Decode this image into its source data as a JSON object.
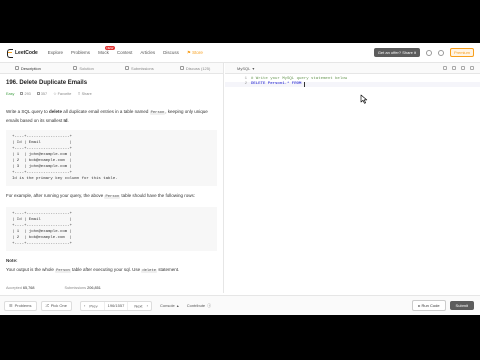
{
  "nav": {
    "logo": "LeetCode",
    "links": [
      "Explore",
      "Problems",
      "Mock",
      "Contest",
      "Articles",
      "Discuss"
    ],
    "hot_badge": "NEW",
    "store": "Store",
    "offer": "Get an offer? Share it",
    "premium": "Premium"
  },
  "tabs": [
    "Description",
    "Solution",
    "Submissions",
    "Discuss (125)"
  ],
  "problem": {
    "title": "196. Delete Duplicate Emails",
    "difficulty": "Easy",
    "likes": "293",
    "dislikes": "357",
    "favorite": "Favorite",
    "share": "Share",
    "desc_pre": "Write a SQL query to ",
    "desc_bold": "delete",
    "desc_mid": " all duplicate email entries in a table named ",
    "desc_table": "Person",
    "desc_post": ", keeping only unique emails based on its smallest ",
    "desc_id": "Id",
    "table1": "+----+------------------+\n| Id | Email            |\n+----+------------------+\n| 1  | john@example.com |\n| 2  | bob@example.com  |\n| 3  | john@example.com |\n+----+------------------+\nId is the primary key column for this table.",
    "example_pre": "For example, after running your query, the above ",
    "example_table": "Person",
    "example_post": " table should have the following rows:",
    "table2": "+----+------------------+\n| Id | Email            |\n+----+------------------+\n| 1  | john@example.com |\n| 2  | bob@example.com  |\n+----+------------------+",
    "note_label": "Note:",
    "note_pre": "Your output is the whole ",
    "note_table": "Person",
    "note_mid": " table after executing your sql. Use ",
    "note_kw": "delete",
    "note_post": " statement."
  },
  "stats": {
    "accepted_label": "Accepted",
    "accepted": "65,768",
    "submissions_label": "Submissions",
    "submissions": "206,851"
  },
  "editor": {
    "language": "MySQL",
    "lines": [
      {
        "n": "1",
        "text": "# Write your MySQL query statement below"
      },
      {
        "n": "2",
        "text": "DELETE Person1.* FROM "
      }
    ]
  },
  "bottom": {
    "problems": "Problems",
    "pick_one": "Pick One",
    "prev": "Prev",
    "page": "196/1557",
    "next": "Next",
    "console": "Console",
    "contribute": "Contribute",
    "run": "Run Code",
    "submit": "Submit"
  }
}
